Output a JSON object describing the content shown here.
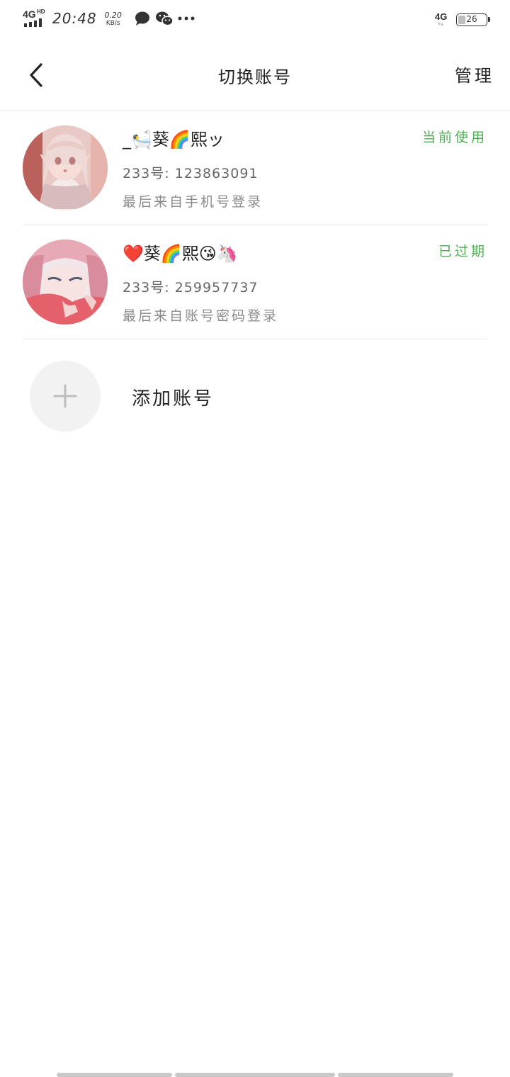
{
  "status_bar": {
    "network": "4G",
    "network_hd": "HD",
    "time": "20:48",
    "speed_value": "0.20",
    "speed_unit": "KB/s",
    "notification_icons": [
      "message-icon",
      "wechat-icon",
      "more-dots-icon"
    ],
    "network_right": "4G",
    "battery": "26"
  },
  "header": {
    "title": "切换账号",
    "manage_label": "管理"
  },
  "accounts": [
    {
      "name": "_🛀葵🌈熙ッ",
      "id_line": "233号: 123863091",
      "login_method": "最后来自手机号登录",
      "status": "当前使用",
      "status_color": "#4caf50"
    },
    {
      "name": "❤️葵🌈熙😘🦄",
      "id_line": "233号: 259957737",
      "login_method": "最后来自账号密码登录",
      "status": "已过期",
      "status_color": "#4caf50"
    }
  ],
  "add_account": {
    "label": "添加账号"
  }
}
